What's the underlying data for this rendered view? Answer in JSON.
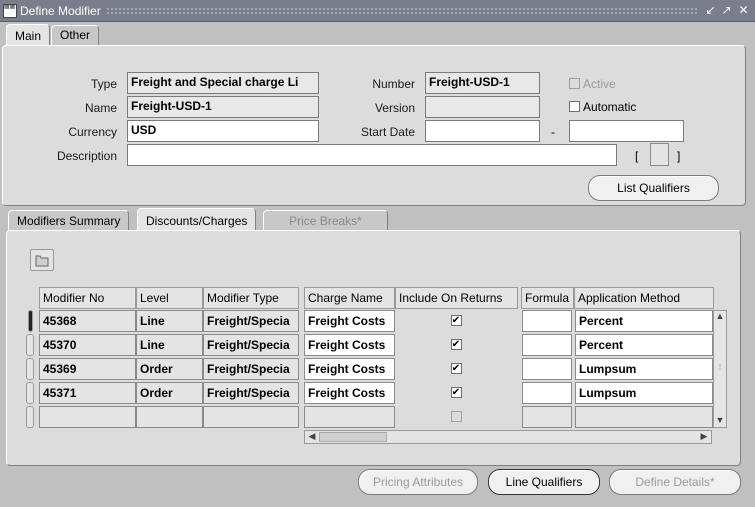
{
  "window": {
    "title": "Define Modifier",
    "controls": [
      "minimize",
      "maximize",
      "close"
    ]
  },
  "top_tabs": [
    "Main",
    "Other"
  ],
  "header": {
    "type_label": "Type",
    "type_value": "Freight and Special charge Li",
    "name_label": "Name",
    "name_value": "Freight-USD-1",
    "currency_label": "Currency",
    "currency_value": "USD",
    "description_label": "Description",
    "description_value": "",
    "number_label": "Number",
    "number_value": "Freight-USD-1",
    "version_label": "Version",
    "version_value": "",
    "start_date_label": "Start Date",
    "start_date_value": "",
    "dash": "-",
    "end_date_value": "",
    "active_label": "Active",
    "automatic_label": "Automatic",
    "bracket_open": "[",
    "bracket_close": "]",
    "list_qualifiers_label": "List Qualifiers"
  },
  "lower_tabs": [
    "Modifiers Summary",
    "Discounts/Charges",
    "Price Breaks*"
  ],
  "table": {
    "columns": [
      "Modifier No",
      "Level",
      "Modifier Type",
      "Charge Name",
      "Include On Returns",
      "Formula",
      "Application Method"
    ],
    "rows": [
      {
        "no": "45368",
        "level": "Line",
        "type": "Freight/Specia",
        "charge": "Freight Costs",
        "include": true,
        "formula": "",
        "method": "Percent"
      },
      {
        "no": "45370",
        "level": "Line",
        "type": "Freight/Specia",
        "charge": "Freight Costs",
        "include": true,
        "formula": "",
        "method": "Percent"
      },
      {
        "no": "45369",
        "level": "Order",
        "type": "Freight/Specia",
        "charge": "Freight Costs",
        "include": true,
        "formula": "",
        "method": "Lumpsum"
      },
      {
        "no": "45371",
        "level": "Order",
        "type": "Freight/Specia",
        "charge": "Freight Costs",
        "include": true,
        "formula": "",
        "method": "Lumpsum"
      }
    ]
  },
  "buttons": {
    "pricing_attributes": "Pricing Attributes",
    "line_qualifiers": "Line Qualifiers",
    "define_details": "Define Details*"
  },
  "icons": {
    "folder": "folder-icon"
  },
  "colors": {
    "titlebar": "#7a7e8c",
    "panel": "#dcdcdc",
    "background": "#c0c0c0"
  }
}
